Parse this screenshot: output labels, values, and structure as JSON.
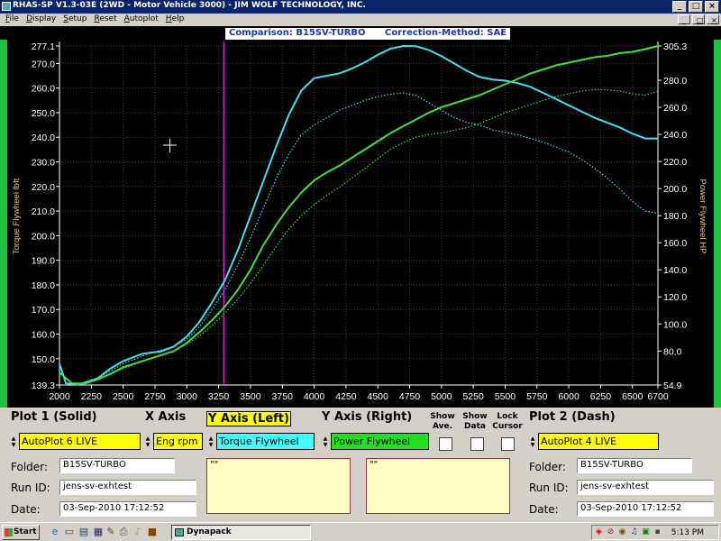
{
  "window": {
    "title": "RHAS-SP V1.3-03E  (2WD - Motor Vehicle 3000) - JIM WOLF TECHNOLOGY, INC.",
    "buttons": [
      "_",
      "□",
      "×"
    ],
    "mdi_buttons": [
      "_",
      "□",
      "×"
    ]
  },
  "menu": [
    "File",
    "Display",
    "Setup",
    "Reset",
    "Autoplot",
    "Help"
  ],
  "plot_header": {
    "comparison": "Comparison: B15SV-TURBO",
    "correction": "Correction-Method: SAE"
  },
  "chart_data": {
    "type": "line",
    "xlabel": "",
    "ylabel_left": "Torque Flywheel lbft",
    "ylabel_right": "Power Flywheel HP",
    "x_ticks": [
      2000,
      2250,
      2500,
      2750,
      3000,
      3250,
      3500,
      3750,
      4000,
      4250,
      4500,
      4750,
      5000,
      5250,
      5500,
      5750,
      6000,
      6250,
      6500,
      6700
    ],
    "xlim": [
      2000,
      6700
    ],
    "y_left_ticks": [
      "139.3",
      "150.0",
      "160.0",
      "170.0",
      "180.0",
      "190.0",
      "200.0",
      "210.0",
      "220.0",
      "230.0",
      "240.0",
      "250.0",
      "260.0",
      "270.0",
      "277.1"
    ],
    "ylim_left": [
      139.3,
      277.1
    ],
    "y_right_ticks": [
      "54.9",
      "80.0",
      "100.0",
      "120.0",
      "140.0",
      "160.0",
      "180.0",
      "200.0",
      "220.0",
      "240.0",
      "260.0",
      "280.0",
      "305.3"
    ],
    "ylim_right": [
      54.9,
      305.3
    ],
    "grid": true,
    "cursor_x": 3290,
    "series": [
      {
        "axis": "left",
        "color": "#40e0f0",
        "style": "solid",
        "points": [
          [
            2000,
            148
          ],
          [
            2050,
            140
          ],
          [
            2150,
            139.5
          ],
          [
            2300,
            142
          ],
          [
            2400,
            146
          ],
          [
            2500,
            149
          ],
          [
            2650,
            152
          ],
          [
            2800,
            153
          ],
          [
            2900,
            155
          ],
          [
            3000,
            159
          ],
          [
            3100,
            165
          ],
          [
            3200,
            173
          ],
          [
            3300,
            182
          ],
          [
            3400,
            194
          ],
          [
            3500,
            208
          ],
          [
            3600,
            222
          ],
          [
            3700,
            236
          ],
          [
            3800,
            249
          ],
          [
            3900,
            259
          ],
          [
            4000,
            264
          ],
          [
            4100,
            265
          ],
          [
            4200,
            266
          ],
          [
            4300,
            268
          ],
          [
            4400,
            270.5
          ],
          [
            4500,
            273.5
          ],
          [
            4600,
            276
          ],
          [
            4700,
            277.1
          ],
          [
            4800,
            277
          ],
          [
            4900,
            275.5
          ],
          [
            5000,
            273
          ],
          [
            5100,
            270
          ],
          [
            5200,
            267
          ],
          [
            5300,
            264.5
          ],
          [
            5400,
            263.5
          ],
          [
            5500,
            263
          ],
          [
            5600,
            262
          ],
          [
            5700,
            260.5
          ],
          [
            5800,
            258
          ],
          [
            5900,
            255.5
          ],
          [
            6000,
            253
          ],
          [
            6100,
            250.5
          ],
          [
            6200,
            248
          ],
          [
            6300,
            246
          ],
          [
            6400,
            244
          ],
          [
            6500,
            241.5
          ],
          [
            6600,
            239.5
          ],
          [
            6700,
            239.5
          ]
        ]
      },
      {
        "axis": "left",
        "color": "#40e0f0",
        "style": "dotted",
        "points": [
          [
            2000,
            148
          ],
          [
            2050,
            140
          ],
          [
            2150,
            139.5
          ],
          [
            2300,
            142
          ],
          [
            2500,
            148
          ],
          [
            2700,
            152
          ],
          [
            2900,
            155
          ],
          [
            3000,
            158
          ],
          [
            3100,
            163
          ],
          [
            3200,
            170
          ],
          [
            3300,
            178
          ],
          [
            3400,
            188
          ],
          [
            3500,
            199
          ],
          [
            3600,
            211
          ],
          [
            3700,
            223
          ],
          [
            3800,
            233
          ],
          [
            3900,
            241
          ],
          [
            4000,
            245
          ],
          [
            4100,
            248
          ],
          [
            4200,
            251
          ],
          [
            4300,
            253
          ],
          [
            4400,
            255
          ],
          [
            4500,
            256.5
          ],
          [
            4600,
            257.5
          ],
          [
            4700,
            258
          ],
          [
            4800,
            257
          ],
          [
            4900,
            254
          ],
          [
            5000,
            251
          ],
          [
            5100,
            248
          ],
          [
            5200,
            246
          ],
          [
            5300,
            245
          ],
          [
            5400,
            243
          ],
          [
            5500,
            242
          ],
          [
            5600,
            241
          ],
          [
            5700,
            239.5
          ],
          [
            5800,
            238
          ],
          [
            5900,
            236
          ],
          [
            6000,
            234
          ],
          [
            6100,
            231
          ],
          [
            6200,
            227.5
          ],
          [
            6300,
            223.5
          ],
          [
            6400,
            219
          ],
          [
            6500,
            214
          ],
          [
            6600,
            210
          ],
          [
            6700,
            209
          ]
        ]
      },
      {
        "axis": "right",
        "color": "#40e040",
        "style": "solid",
        "points": [
          [
            2000,
            64
          ],
          [
            2100,
            56
          ],
          [
            2200,
            56
          ],
          [
            2300,
            59
          ],
          [
            2400,
            63
          ],
          [
            2500,
            68
          ],
          [
            2600,
            71
          ],
          [
            2700,
            74
          ],
          [
            2800,
            77
          ],
          [
            2900,
            80
          ],
          [
            3000,
            86
          ],
          [
            3100,
            94
          ],
          [
            3200,
            103
          ],
          [
            3300,
            113
          ],
          [
            3400,
            125
          ],
          [
            3500,
            140
          ],
          [
            3600,
            158
          ],
          [
            3700,
            173
          ],
          [
            3800,
            186
          ],
          [
            3900,
            197
          ],
          [
            4000,
            206
          ],
          [
            4100,
            212
          ],
          [
            4200,
            217
          ],
          [
            4300,
            223
          ],
          [
            4400,
            229
          ],
          [
            4500,
            235
          ],
          [
            4600,
            241
          ],
          [
            4700,
            246
          ],
          [
            4800,
            251
          ],
          [
            4900,
            256
          ],
          [
            5000,
            260
          ],
          [
            5100,
            263
          ],
          [
            5200,
            266
          ],
          [
            5300,
            269
          ],
          [
            5400,
            273
          ],
          [
            5500,
            277
          ],
          [
            5600,
            281
          ],
          [
            5700,
            285
          ],
          [
            5800,
            288
          ],
          [
            5900,
            291
          ],
          [
            6000,
            293
          ],
          [
            6100,
            295
          ],
          [
            6200,
            297
          ],
          [
            6300,
            298
          ],
          [
            6400,
            300
          ],
          [
            6500,
            301
          ],
          [
            6600,
            303
          ],
          [
            6700,
            305.3
          ]
        ]
      },
      {
        "axis": "right",
        "color": "#40e040",
        "style": "dotted",
        "points": [
          [
            2000,
            64
          ],
          [
            2100,
            56
          ],
          [
            2200,
            56
          ],
          [
            2300,
            59
          ],
          [
            2500,
            67
          ],
          [
            2700,
            74
          ],
          [
            2900,
            80
          ],
          [
            3000,
            85
          ],
          [
            3100,
            91
          ],
          [
            3200,
            99
          ],
          [
            3300,
            108
          ],
          [
            3400,
            118
          ],
          [
            3500,
            130
          ],
          [
            3600,
            143
          ],
          [
            3700,
            157
          ],
          [
            3800,
            170
          ],
          [
            3900,
            180
          ],
          [
            4000,
            188
          ],
          [
            4100,
            195
          ],
          [
            4200,
            201
          ],
          [
            4300,
            208
          ],
          [
            4400,
            215
          ],
          [
            4500,
            222
          ],
          [
            4600,
            229
          ],
          [
            4700,
            234
          ],
          [
            4800,
            238
          ],
          [
            4900,
            240
          ],
          [
            5000,
            241
          ],
          [
            5100,
            243
          ],
          [
            5200,
            245
          ],
          [
            5300,
            248
          ],
          [
            5400,
            252
          ],
          [
            5500,
            256
          ],
          [
            5600,
            259
          ],
          [
            5700,
            262
          ],
          [
            5800,
            265
          ],
          [
            5900,
            268
          ],
          [
            6000,
            270
          ],
          [
            6100,
            272
          ],
          [
            6200,
            273
          ],
          [
            6300,
            273
          ],
          [
            6400,
            272
          ],
          [
            6500,
            270
          ],
          [
            6600,
            269
          ],
          [
            6700,
            272
          ]
        ]
      }
    ]
  },
  "controls": {
    "plot1_title": "Plot 1 (Solid)",
    "xaxis_title": "X Axis",
    "yleft_title": "Y Axis (Left)",
    "yright_title": "Y Axis (Right)",
    "show_ave": "Show Ave.",
    "show_data": "Show Data",
    "lock_cursor": "Lock Cursor",
    "plot2_title": "Plot 2 (Dash)",
    "plot1_value": "AutoPlot 6 LIVE",
    "xaxis_value": "Eng rpm",
    "yleft_value": "Torque Flywheel",
    "yright_value": "Power Flywheel",
    "plot2_value": "AutoPlot 4 LIVE"
  },
  "info": {
    "folder_label": "Folder:",
    "runid_label": "Run ID:",
    "date_label": "Date:",
    "left": {
      "folder": "B15SV-TURBO",
      "runid": "jens-sv-exhtest",
      "date": "03-Sep-2010  17:12:52"
    },
    "right": {
      "folder": "B15SV-TURBO",
      "runid": "jens-sv-exhtest",
      "date": "03-Sep-2010  17:12:52"
    },
    "notes_left": "\"\"",
    "notes_right": "\"\""
  },
  "taskbar": {
    "start": "Start",
    "task": "Dynapack",
    "clock": "5:13 PM"
  },
  "colors": {
    "torque": "#40e0f0",
    "power": "#40e040",
    "cursor": "#c020c0",
    "field_yellow": "#ffff00",
    "field_cyan": "#40ffff",
    "field_green": "#20e020"
  }
}
